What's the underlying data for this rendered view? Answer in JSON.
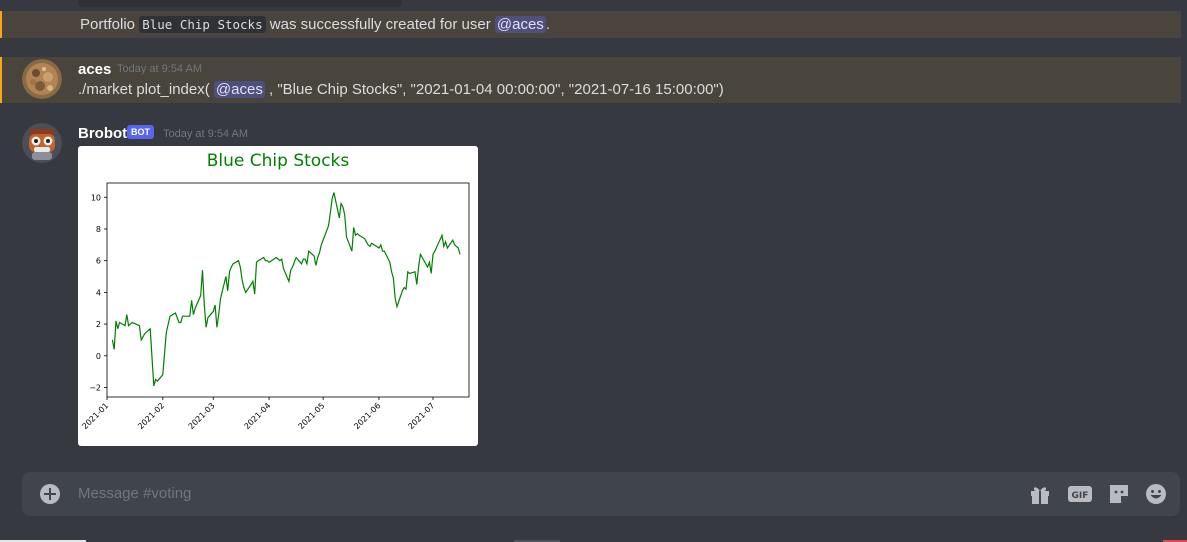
{
  "system_message": {
    "prefix": "Portfolio ",
    "portfolio_name": "Blue Chip Stocks",
    "middle": " was successfully created for user ",
    "mention": "@aces",
    "suffix": "."
  },
  "command_message": {
    "username": "aces",
    "timestamp": "Today at 9:54 AM",
    "cmd_prefix": "./market plot_index( ",
    "mention": "@aces",
    "cmd_suffix": " , \"Blue Chip Stocks\", \"2021-01-04 00:00:00\", \"2021-07-16 15:00:00\")"
  },
  "bot_message": {
    "username": "Brobot",
    "badge": "BOT",
    "timestamp": "Today at 9:54 AM"
  },
  "composer": {
    "placeholder": "Message #voting",
    "gif_label": "GIF"
  },
  "colors": {
    "background": "#36393f",
    "highlight": "#49443c",
    "highlight_border": "#faa61a",
    "mention_bg": "#4a4f8a",
    "bot_badge": "#5865f2",
    "line": "#008000"
  },
  "icons": [
    "add-attachment-icon",
    "gift-icon",
    "gif-icon",
    "sticker-icon",
    "emoji-icon"
  ],
  "chart_data": {
    "type": "line",
    "title": "Blue Chip Stocks",
    "x_ticks": [
      "2021-01",
      "2021-02",
      "2021-03",
      "2021-04",
      "2021-05",
      "2021-06",
      "2021-07"
    ],
    "y_ticks": [
      -2,
      0,
      2,
      4,
      6,
      8,
      10
    ],
    "xlim": [
      "2021-01-01",
      "2021-07-21"
    ],
    "ylim": [
      -2.6,
      10.9
    ],
    "series": [
      {
        "color": "#008000",
        "points": [
          [
            "2021-01-04",
            1.0
          ],
          [
            "2021-01-05",
            0.4
          ],
          [
            "2021-01-06",
            2.2
          ],
          [
            "2021-01-07",
            1.7
          ],
          [
            "2021-01-08",
            2.1
          ],
          [
            "2021-01-11",
            1.9
          ],
          [
            "2021-01-12",
            2.6
          ],
          [
            "2021-01-13",
            1.9
          ],
          [
            "2021-01-14",
            2.0
          ],
          [
            "2021-01-15",
            2.1
          ],
          [
            "2021-01-19",
            1.9
          ],
          [
            "2021-01-20",
            1.0
          ],
          [
            "2021-01-21",
            1.2
          ],
          [
            "2021-01-22",
            1.4
          ],
          [
            "2021-01-25",
            1.7
          ],
          [
            "2021-01-26",
            -0.1
          ],
          [
            "2021-01-27",
            -1.9
          ],
          [
            "2021-01-28",
            -1.5
          ],
          [
            "2021-01-29",
            -1.6
          ],
          [
            "2021-02-01",
            -1.2
          ],
          [
            "2021-02-02",
            0.2
          ],
          [
            "2021-02-03",
            1.5
          ],
          [
            "2021-02-04",
            2.0
          ],
          [
            "2021-02-05",
            2.5
          ],
          [
            "2021-02-08",
            2.7
          ],
          [
            "2021-02-09",
            2.4
          ],
          [
            "2021-02-10",
            2.1
          ],
          [
            "2021-02-11",
            2.1
          ],
          [
            "2021-02-12",
            2.5
          ],
          [
            "2021-02-16",
            2.5
          ],
          [
            "2021-02-17",
            3.5
          ],
          [
            "2021-02-18",
            2.6
          ],
          [
            "2021-02-19",
            3.0
          ],
          [
            "2021-02-22",
            3.8
          ],
          [
            "2021-02-23",
            5.4
          ],
          [
            "2021-02-24",
            3.2
          ],
          [
            "2021-02-25",
            1.8
          ],
          [
            "2021-02-26",
            2.4
          ],
          [
            "2021-03-01",
            2.8
          ],
          [
            "2021-03-02",
            3.2
          ],
          [
            "2021-03-03",
            1.8
          ],
          [
            "2021-03-04",
            2.6
          ],
          [
            "2021-03-05",
            3.6
          ],
          [
            "2021-03-08",
            5.0
          ],
          [
            "2021-03-09",
            4.1
          ],
          [
            "2021-03-10",
            5.3
          ],
          [
            "2021-03-11",
            5.6
          ],
          [
            "2021-03-12",
            5.8
          ],
          [
            "2021-03-15",
            6.0
          ],
          [
            "2021-03-16",
            5.6
          ],
          [
            "2021-03-17",
            4.8
          ],
          [
            "2021-03-18",
            4.3
          ],
          [
            "2021-03-19",
            4.0
          ],
          [
            "2021-03-22",
            4.5
          ],
          [
            "2021-03-23",
            4.7
          ],
          [
            "2021-03-24",
            3.9
          ],
          [
            "2021-03-25",
            5.9
          ],
          [
            "2021-03-26",
            6.0
          ],
          [
            "2021-03-29",
            6.2
          ],
          [
            "2021-03-30",
            6.0
          ],
          [
            "2021-03-31",
            6.0
          ],
          [
            "2021-04-01",
            5.9
          ],
          [
            "2021-04-05",
            6.2
          ],
          [
            "2021-04-06",
            6.1
          ],
          [
            "2021-04-07",
            6.0
          ],
          [
            "2021-04-08",
            6.1
          ],
          [
            "2021-04-09",
            5.5
          ],
          [
            "2021-04-12",
            4.7
          ],
          [
            "2021-04-13",
            5.4
          ],
          [
            "2021-04-14",
            5.6
          ],
          [
            "2021-04-15",
            5.9
          ],
          [
            "2021-04-16",
            6.2
          ],
          [
            "2021-04-19",
            5.8
          ],
          [
            "2021-04-20",
            6.1
          ],
          [
            "2021-04-21",
            6.1
          ],
          [
            "2021-04-22",
            5.8
          ],
          [
            "2021-04-23",
            6.6
          ],
          [
            "2021-04-26",
            6.3
          ],
          [
            "2021-04-27",
            5.7
          ],
          [
            "2021-04-28",
            6.2
          ],
          [
            "2021-04-29",
            6.5
          ],
          [
            "2021-04-30",
            7.0
          ],
          [
            "2021-05-03",
            7.9
          ],
          [
            "2021-05-04",
            8.2
          ],
          [
            "2021-05-05",
            9.0
          ],
          [
            "2021-05-06",
            9.9
          ],
          [
            "2021-05-07",
            10.3
          ],
          [
            "2021-05-10",
            8.7
          ],
          [
            "2021-05-11",
            9.6
          ],
          [
            "2021-05-12",
            9.4
          ],
          [
            "2021-05-13",
            8.9
          ],
          [
            "2021-05-14",
            7.5
          ],
          [
            "2021-05-17",
            6.6
          ],
          [
            "2021-05-18",
            8.1
          ],
          [
            "2021-05-19",
            7.6
          ],
          [
            "2021-05-20",
            7.7
          ],
          [
            "2021-05-21",
            7.6
          ],
          [
            "2021-05-24",
            7.4
          ],
          [
            "2021-05-25",
            7.2
          ],
          [
            "2021-05-26",
            7.0
          ],
          [
            "2021-05-27",
            6.9
          ],
          [
            "2021-05-28",
            7.1
          ],
          [
            "2021-06-01",
            6.8
          ],
          [
            "2021-06-02",
            7.0
          ],
          [
            "2021-06-03",
            6.6
          ],
          [
            "2021-06-04",
            6.6
          ],
          [
            "2021-06-07",
            5.9
          ],
          [
            "2021-06-08",
            5.3
          ],
          [
            "2021-06-09",
            4.9
          ],
          [
            "2021-06-10",
            3.6
          ],
          [
            "2021-06-11",
            3.1
          ],
          [
            "2021-06-14",
            4.1
          ],
          [
            "2021-06-15",
            4.3
          ],
          [
            "2021-06-16",
            4.2
          ],
          [
            "2021-06-17",
            5.3
          ],
          [
            "2021-06-18",
            5.2
          ],
          [
            "2021-06-21",
            5.3
          ],
          [
            "2021-06-22",
            4.5
          ],
          [
            "2021-06-23",
            5.6
          ],
          [
            "2021-06-24",
            6.4
          ],
          [
            "2021-06-25",
            6.2
          ],
          [
            "2021-06-28",
            5.6
          ],
          [
            "2021-06-29",
            5.9
          ],
          [
            "2021-06-30",
            5.2
          ],
          [
            "2021-07-01",
            6.4
          ],
          [
            "2021-07-02",
            6.6
          ],
          [
            "2021-07-06",
            7.6
          ],
          [
            "2021-07-07",
            6.9
          ],
          [
            "2021-07-08",
            7.2
          ],
          [
            "2021-07-09",
            6.8
          ],
          [
            "2021-07-12",
            7.3
          ],
          [
            "2021-07-13",
            7.0
          ],
          [
            "2021-07-14",
            6.9
          ],
          [
            "2021-07-15",
            6.8
          ],
          [
            "2021-07-16",
            6.4
          ]
        ]
      }
    ]
  }
}
